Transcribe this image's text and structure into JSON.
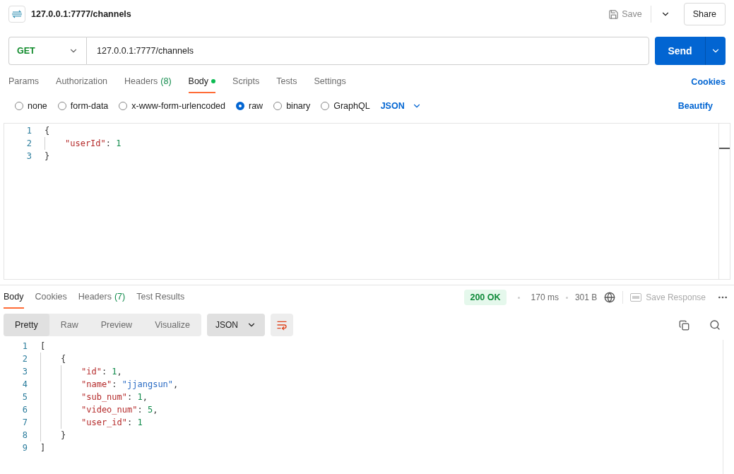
{
  "header": {
    "title": "127.0.0.1:7777/channels",
    "save_label": "Save",
    "share_label": "Share"
  },
  "request": {
    "method": "GET",
    "url": "127.0.0.1:7777/channels",
    "send_label": "Send"
  },
  "request_tabs": [
    {
      "label": "Params",
      "selected": false
    },
    {
      "label": "Authorization",
      "selected": false
    },
    {
      "label": "Headers",
      "count": "(8)",
      "selected": false
    },
    {
      "label": "Body",
      "dot": true,
      "selected": true
    },
    {
      "label": "Scripts",
      "selected": false
    },
    {
      "label": "Tests",
      "selected": false
    },
    {
      "label": "Settings",
      "selected": false
    }
  ],
  "cookies_link": "Cookies",
  "body_types": [
    {
      "label": "none",
      "selected": false
    },
    {
      "label": "form-data",
      "selected": false
    },
    {
      "label": "x-www-form-urlencoded",
      "selected": false
    },
    {
      "label": "raw",
      "selected": true
    },
    {
      "label": "binary",
      "selected": false
    },
    {
      "label": "GraphQL",
      "selected": false
    }
  ],
  "raw_format": "JSON",
  "beautify_link": "Beautify",
  "request_body": [
    {
      "number": "1",
      "tokens": [
        {
          "kind": "punct",
          "text": "{"
        }
      ],
      "children": [
        {
          "number": "2",
          "tokens": [
            {
              "kind": "key",
              "text": "\"userId\""
            },
            {
              "kind": "punct",
              "text": ": "
            },
            {
              "kind": "number",
              "text": "1"
            }
          ]
        }
      ]
    },
    {
      "number": "3",
      "tokens": [
        {
          "kind": "punct",
          "text": "}"
        }
      ]
    }
  ],
  "response_tabs": [
    {
      "label": "Body",
      "selected": true
    },
    {
      "label": "Cookies",
      "selected": false
    },
    {
      "label": "Headers",
      "count": "(7)",
      "selected": false
    },
    {
      "label": "Test Results",
      "selected": false
    }
  ],
  "status": {
    "code": "200 OK",
    "time": "170 ms",
    "size": "301 B",
    "save_response": "Save Response"
  },
  "view_modes": [
    {
      "label": "Pretty",
      "selected": true
    },
    {
      "label": "Raw",
      "selected": false
    },
    {
      "label": "Preview",
      "selected": false
    },
    {
      "label": "Visualize",
      "selected": false
    }
  ],
  "response_format": "JSON",
  "response_body": [
    {
      "number": "1",
      "tokens": [
        {
          "kind": "punct",
          "text": "["
        }
      ],
      "children": [
        {
          "number": "2",
          "tokens": [
            {
              "kind": "punct",
              "text": "{"
            }
          ],
          "children": [
            {
              "number": "3",
              "tokens": [
                {
                  "kind": "key",
                  "text": "\"id\""
                },
                {
                  "kind": "punct",
                  "text": ": "
                },
                {
                  "kind": "number",
                  "text": "1"
                },
                {
                  "kind": "punct",
                  "text": ","
                }
              ]
            },
            {
              "number": "4",
              "tokens": [
                {
                  "kind": "key",
                  "text": "\"name\""
                },
                {
                  "kind": "punct",
                  "text": ": "
                },
                {
                  "kind": "string",
                  "text": "\"jjangsun\""
                },
                {
                  "kind": "punct",
                  "text": ","
                }
              ]
            },
            {
              "number": "5",
              "tokens": [
                {
                  "kind": "key",
                  "text": "\"sub_num\""
                },
                {
                  "kind": "punct",
                  "text": ": "
                },
                {
                  "kind": "number",
                  "text": "1"
                },
                {
                  "kind": "punct",
                  "text": ","
                }
              ]
            },
            {
              "number": "6",
              "tokens": [
                {
                  "kind": "key",
                  "text": "\"video_num\""
                },
                {
                  "kind": "punct",
                  "text": ": "
                },
                {
                  "kind": "number",
                  "text": "5"
                },
                {
                  "kind": "punct",
                  "text": ","
                }
              ]
            },
            {
              "number": "7",
              "tokens": [
                {
                  "kind": "key",
                  "text": "\"user_id\""
                },
                {
                  "kind": "punct",
                  "text": ": "
                },
                {
                  "kind": "number",
                  "text": "1"
                }
              ]
            }
          ]
        },
        {
          "number": "8",
          "tokens": [
            {
              "kind": "punct",
              "text": "}"
            }
          ]
        }
      ]
    },
    {
      "number": "9",
      "tokens": [
        {
          "kind": "punct",
          "text": "]"
        }
      ]
    }
  ]
}
